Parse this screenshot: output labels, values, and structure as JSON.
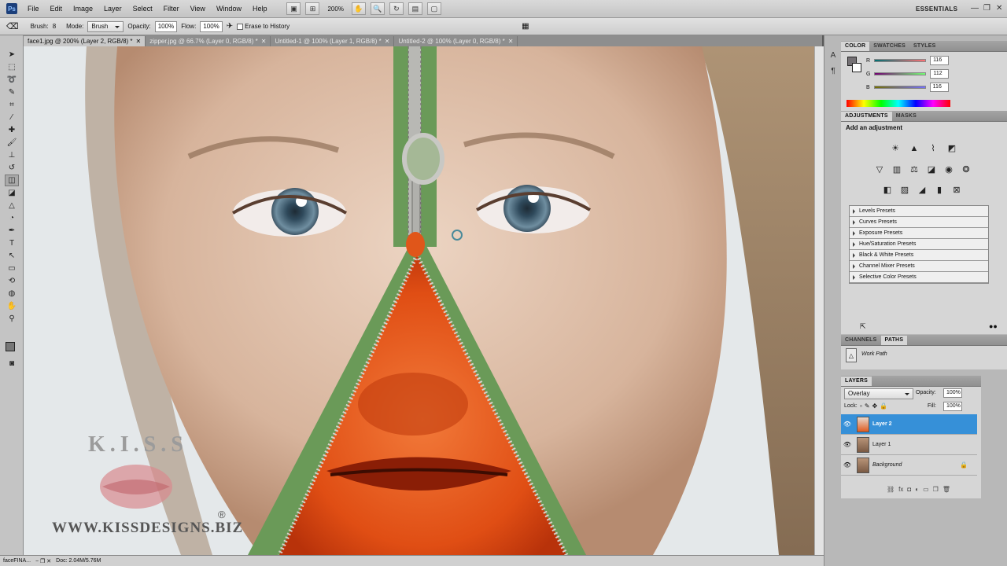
{
  "menubar": {
    "logo": "Ps",
    "items": [
      "File",
      "Edit",
      "Image",
      "Layer",
      "Select",
      "Filter",
      "View",
      "Window",
      "Help"
    ],
    "zoom": "200%",
    "workspace": "ESSENTIALS"
  },
  "options_bar": {
    "brush_label": "Brush:",
    "brush_size": "8",
    "mode_label": "Mode:",
    "mode_value": "Brush",
    "opacity_label": "Opacity:",
    "opacity_value": "100%",
    "flow_label": "Flow:",
    "flow_value": "100%",
    "erase_history_label": "Erase to History"
  },
  "document_tabs": [
    {
      "label": "face1.jpg @ 200% (Layer 2, RGB/8) *",
      "active": true
    },
    {
      "label": "zipper.jpg @ 66.7% (Layer 0, RGB/8) *",
      "active": false
    },
    {
      "label": "Untitled-1 @ 100% (Layer 1, RGB/8) *",
      "active": false
    },
    {
      "label": "Untitled-2 @ 100% (Layer 0, RGB/8) *",
      "active": false
    }
  ],
  "watermark": {
    "brand_letters": "K.I.S.S",
    "url": "WWW.KISSDESIGNS.BIZ",
    "registered": "®"
  },
  "status_bar": {
    "doc_name": "faceFINA...",
    "doc_size": "Doc: 2.04M/5.76M"
  },
  "color_panel": {
    "tabs": [
      "COLOR",
      "SWATCHES",
      "STYLES"
    ],
    "channels": [
      {
        "label": "R",
        "value": "116"
      },
      {
        "label": "G",
        "value": "112"
      },
      {
        "label": "B",
        "value": "116"
      }
    ],
    "foreground_color": "#747074"
  },
  "adjustments_panel": {
    "tabs": [
      "ADJUSTMENTS",
      "MASKS"
    ],
    "heading": "Add an adjustment",
    "presets": [
      "Levels Presets",
      "Curves Presets",
      "Exposure Presets",
      "Hue/Saturation Presets",
      "Black & White Presets",
      "Channel Mixer Presets",
      "Selective Color Presets"
    ]
  },
  "paths_panel": {
    "tabs": [
      "CHANNELS",
      "PATHS"
    ],
    "items": [
      "Work Path"
    ]
  },
  "layers_panel": {
    "title": "LAYERS",
    "blend_mode": "Overlay",
    "opacity_label": "Opacity:",
    "opacity_value": "100%",
    "lock_label": "Lock:",
    "fill_label": "Fill:",
    "fill_value": "100%",
    "layers": [
      {
        "name": "Layer 2",
        "selected": true,
        "locked": false
      },
      {
        "name": "Layer 1",
        "selected": false,
        "locked": false
      },
      {
        "name": "Background",
        "selected": false,
        "locked": true
      }
    ]
  },
  "colors": {
    "selection_blue": "#3690d8",
    "zipper_tape": "#6a9a58",
    "inner_orange": "#e8541a"
  }
}
